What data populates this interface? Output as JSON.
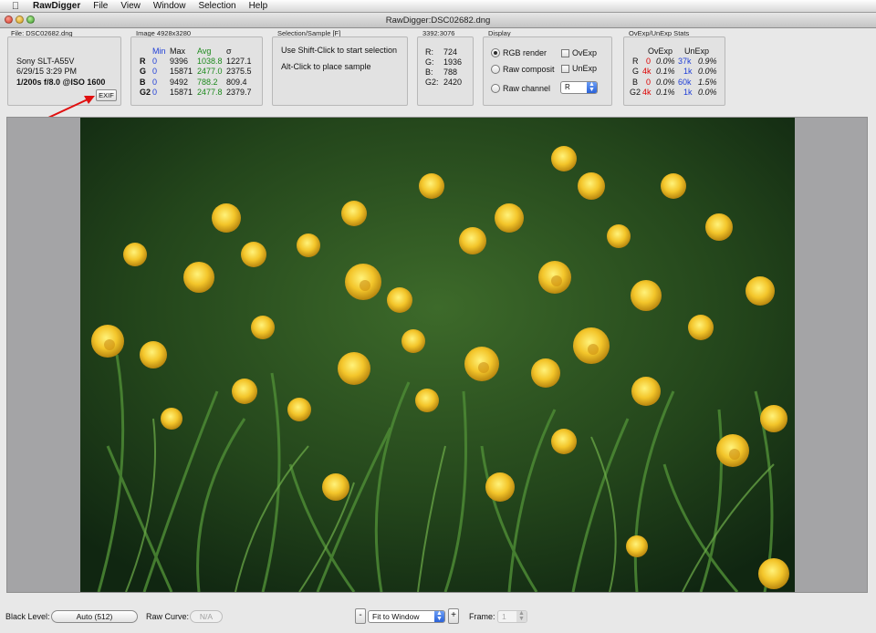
{
  "menubar": {
    "app": "RawDigger",
    "items": [
      "File",
      "View",
      "Window",
      "Selection",
      "Help"
    ]
  },
  "window": {
    "title": "RawDigger:DSC02682.dng"
  },
  "file_panel": {
    "label": "File: DSC02682.dng",
    "camera": "Sony SLT-A55V",
    "datetime": "6/29/15 3:29 PM",
    "exposure": "1/200s f/8.0 @ISO 1600",
    "exif_button": "EXIF"
  },
  "image_panel": {
    "label": "Image 4928x3280",
    "headers": [
      "Min",
      "Max",
      "Avg",
      "σ"
    ],
    "rows": [
      {
        "ch": "R",
        "min": "0",
        "max": "9396",
        "avg": "1038.8",
        "sigma": "1227.1"
      },
      {
        "ch": "G",
        "min": "0",
        "max": "15871",
        "avg": "2477.0",
        "sigma": "2375.5"
      },
      {
        "ch": "B",
        "min": "0",
        "max": "9492",
        "avg": "788.2",
        "sigma": "809.4"
      },
      {
        "ch": "G2",
        "min": "0",
        "max": "15871",
        "avg": "2477.8",
        "sigma": "2379.7"
      }
    ]
  },
  "selection_panel": {
    "label": "Selection/Sample [F]",
    "line1": "Use Shift-Click to start selection",
    "line2": "Alt-Click to place sample"
  },
  "coord_panel": {
    "label": "3392:3076",
    "rows": [
      {
        "ch": "R:",
        "val": "724"
      },
      {
        "ch": "G:",
        "val": "1936"
      },
      {
        "ch": "B:",
        "val": "788"
      },
      {
        "ch": "G2:",
        "val": "2420"
      }
    ]
  },
  "display_panel": {
    "label": "Display",
    "rgb_render": "RGB render",
    "raw_composit": "Raw composit",
    "raw_channel": "Raw channel",
    "ovexp": "OvExp",
    "unexp": "UnExp",
    "channel_value": "R",
    "selected": "rgb_render"
  },
  "stats_panel": {
    "label": "OvExp/UnExp Stats",
    "headers": [
      "OvExp",
      "UnExp"
    ],
    "rows": [
      {
        "ch": "R",
        "ov_count": "0",
        "ov_pct": "0.0%",
        "un_count": "37k",
        "un_pct": "0.9%"
      },
      {
        "ch": "G",
        "ov_count": "4k",
        "ov_pct": "0.1%",
        "un_count": "1k",
        "un_pct": "0.0%"
      },
      {
        "ch": "B",
        "ov_count": "0",
        "ov_pct": "0.0%",
        "un_count": "60k",
        "un_pct": "1.5%"
      },
      {
        "ch": "G2",
        "ov_count": "4k",
        "ov_pct": "0.1%",
        "un_count": "1k",
        "un_pct": "0.0%"
      }
    ]
  },
  "bottom_bar": {
    "black_level_label": "Black Level:",
    "black_level_value": "Auto (512)",
    "raw_curve_label": "Raw Curve:",
    "raw_curve_value": "N/A",
    "zoom_minus": "-",
    "zoom_value": "Fit to Window",
    "zoom_plus": "+",
    "frame_label": "Frame:",
    "frame_value": "1"
  },
  "colors": {
    "accent_blue": "#1f3ed6",
    "avg_green": "#1d8a1d",
    "overexposed_red": "#dd0000",
    "annotation_arrow": "#e01010"
  }
}
